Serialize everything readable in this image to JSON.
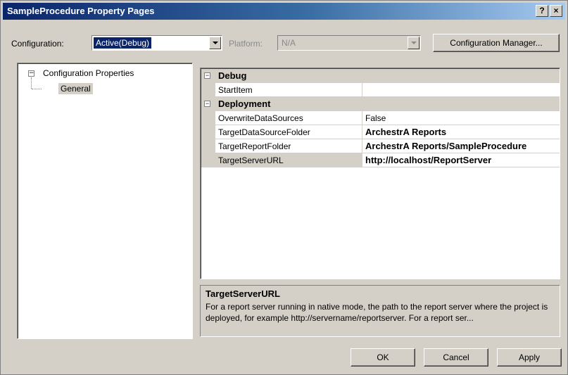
{
  "window": {
    "title": "SampleProcedure Property Pages",
    "help_label": "?",
    "close_label": "×"
  },
  "config_row": {
    "configuration_label": "Configuration:",
    "configuration_value": "Active(Debug)",
    "platform_label": "Platform:",
    "platform_value": "N/A",
    "manager_button": "Configuration Manager..."
  },
  "tree": {
    "root_expander": "−",
    "root_label": "Configuration Properties",
    "child_label": "General"
  },
  "grid": {
    "categories": [
      {
        "expander": "−",
        "label": "Debug"
      },
      {
        "expander": "−",
        "label": "Deployment"
      }
    ],
    "rows": [
      {
        "name": "StartItem",
        "value": ""
      },
      {
        "name": "OverwriteDataSources",
        "value": "False"
      },
      {
        "name": "TargetDataSourceFolder",
        "value": "ArchestrA Reports"
      },
      {
        "name": "TargetReportFolder",
        "value": "ArchestrA Reports/SampleProcedure"
      },
      {
        "name": "TargetServerURL",
        "value": "http://localhost/ReportServer"
      }
    ]
  },
  "description": {
    "title": "TargetServerURL",
    "text": "For a report server running in native mode, the path to the report server where the project is deployed, for example http://servername/reportserver.  For a report ser..."
  },
  "buttons": {
    "ok": "OK",
    "cancel": "Cancel",
    "apply": "Apply"
  },
  "colors": {
    "title_bar": "#0a246a",
    "dialog_face": "#d4d0c8",
    "selection": "#0a246a"
  }
}
